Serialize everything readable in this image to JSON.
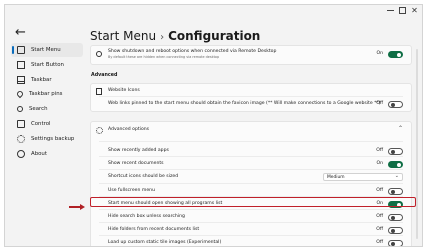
{
  "window": {
    "title_prefix": "Start Menu",
    "title_separator": "›",
    "title_current": "Configuration"
  },
  "sidebar": {
    "items": [
      {
        "label": "Start Menu",
        "icon": "start-menu-icon",
        "active": true
      },
      {
        "label": "Start Button",
        "icon": "start-button-icon"
      },
      {
        "label": "Taskbar",
        "icon": "taskbar-icon"
      },
      {
        "label": "Taskbar pins",
        "icon": "pin-icon"
      },
      {
        "label": "Search",
        "icon": "search-icon"
      },
      {
        "label": "Control",
        "icon": "control-icon"
      },
      {
        "label": "Settings backup",
        "icon": "gear-icon"
      },
      {
        "label": "About",
        "icon": "info-icon"
      }
    ]
  },
  "settings": {
    "shutdown": {
      "label": "Show shutdown and reboot options when connected via Remote Desktop",
      "sub": "By default these are hidden when connecting via remote desktop",
      "state": "On"
    },
    "advanced_heading": "Advanced",
    "website_icons": {
      "title": "Website Icons",
      "label": "Web links pinned to the start menu should obtain the favicon image (** Will make connections to a Google website **)",
      "state": "Off"
    },
    "advanced_options": {
      "title": "Advanced options",
      "rows": [
        {
          "label": "Show recently added apps",
          "state": "Off"
        },
        {
          "label": "Show recent documents",
          "state": "On"
        },
        {
          "label": "Shortcut icons should be sized",
          "dropdown": "Medium"
        },
        {
          "label": "Use fullscreen menu",
          "state": "Off"
        },
        {
          "label": "Start menu should open showing all programs list",
          "state": "On"
        },
        {
          "label": "Hide search box unless searching",
          "state": "Off"
        },
        {
          "label": "Hide folders from recent documents list",
          "state": "Off"
        },
        {
          "label": "Load up custom static tile images (Experimental)",
          "state": "Off"
        }
      ]
    }
  },
  "colors": {
    "accent": "#0a6cbc",
    "toggle_on": "#0f6e45",
    "highlight": "#c0202a"
  }
}
